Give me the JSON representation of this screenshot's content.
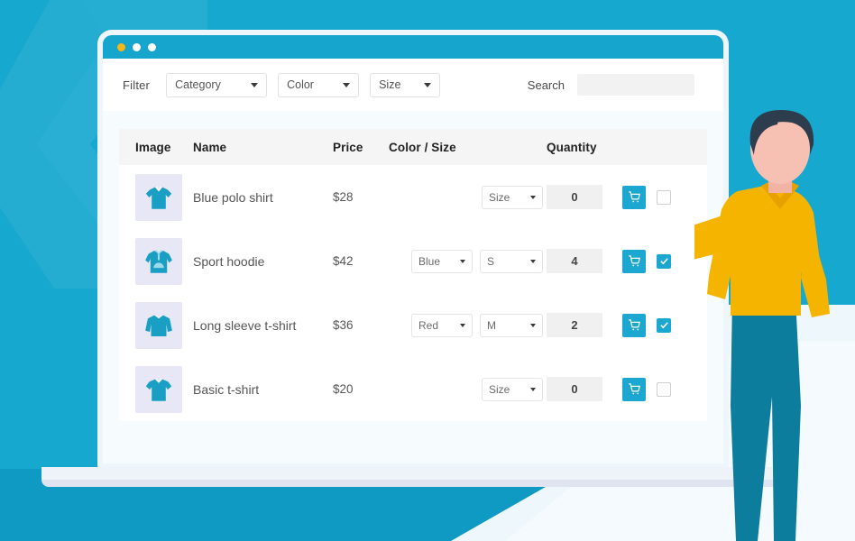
{
  "window": {
    "dots": [
      "amber",
      "white",
      "white"
    ]
  },
  "filter_bar": {
    "label": "Filter",
    "selects": [
      {
        "name": "category",
        "value": "Category"
      },
      {
        "name": "color",
        "value": "Color"
      },
      {
        "name": "size",
        "value": "Size"
      }
    ],
    "search_label": "Search",
    "search_value": "",
    "search_placeholder": ""
  },
  "table": {
    "headers": {
      "image": "Image",
      "name": "Name",
      "price": "Price",
      "color_size": "Color / Size",
      "quantity": "Quantity"
    },
    "rows": [
      {
        "icon": "polo-shirt-icon",
        "name": "Blue polo shirt",
        "price": "$28",
        "color": null,
        "size": "Size",
        "quantity": "0",
        "cart": "cart-icon",
        "checked": false
      },
      {
        "icon": "hoodie-icon",
        "name": "Sport hoodie",
        "price": "$42",
        "color": "Blue",
        "size": "S",
        "quantity": "4",
        "cart": "cart-icon",
        "checked": true
      },
      {
        "icon": "long-sleeve-icon",
        "name": "Long sleeve t-shirt",
        "price": "$36",
        "color": "Red",
        "size": "M",
        "quantity": "2",
        "cart": "cart-icon",
        "checked": true
      },
      {
        "icon": "tshirt-icon",
        "name": "Basic t-shirt",
        "price": "$20",
        "color": null,
        "size": "Size",
        "quantity": "0",
        "cart": "cart-icon",
        "checked": false
      }
    ]
  },
  "colors": {
    "background_blue": "#17a8cf",
    "background_blue_dark": "#2aa9cd",
    "titlebar_blue": "#16a5cd",
    "accent_blue": "#1ba7d0",
    "product_blue": "#1a9fc4",
    "thumb_bg": "#e7e7f6",
    "shirt_yellow": "#f5b400",
    "shirt_yellow_dark": "#e8a200",
    "skin": "#f6c1b2",
    "hair": "#2e3d4d",
    "pants_teal": "#0d7d9e",
    "page_canvas": "#f6fbfd",
    "header_gray": "#f5f5f5",
    "qty_gray": "#f0f0f0"
  },
  "illustration": {
    "person": "person-pointing",
    "hand": "pointing-hand",
    "watermark": "chevron-watermark"
  }
}
